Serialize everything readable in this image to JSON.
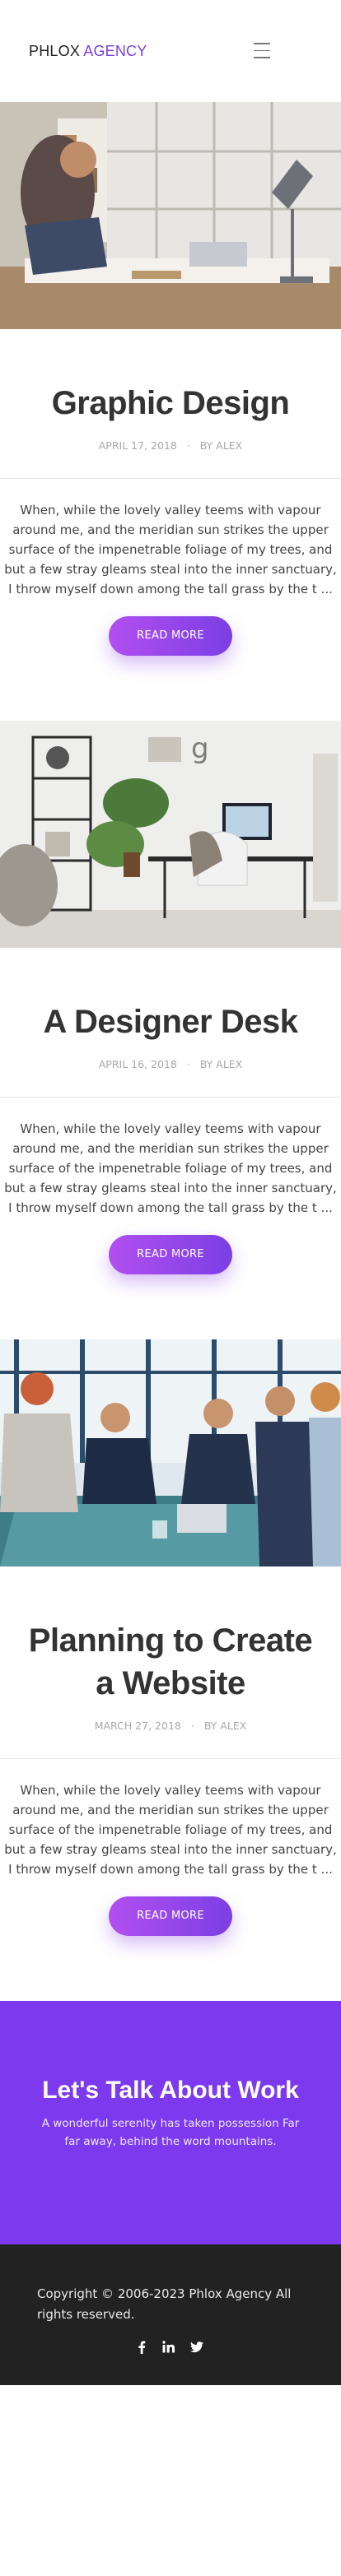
{
  "header": {
    "logo_part1": "PHLOX",
    "logo_part2": "AGENCY",
    "menu_icon": "hamburger-menu-icon"
  },
  "posts": [
    {
      "title": "Graphic Design",
      "date": "APRIL 17, 2018",
      "author": "BY ALEX",
      "excerpt": "When, while the lovely valley teems with vapour around me, and the meridian sun strikes the upper surface of the impenetrable foliage of my trees, and but a few stray gleams steal into the inner sanctuary, I throw myself down among the tall grass by the t ...",
      "button": "READ MORE"
    },
    {
      "title": "A Designer Desk",
      "date": "APRIL 16, 2018",
      "author": "BY ALEX",
      "excerpt": "When, while the lovely valley teems with vapour around me, and the meridian sun strikes the upper surface of the impenetrable foliage of my trees, and but a few stray gleams steal into the inner sanctuary, I throw myself down among the tall grass by the t ...",
      "button": "READ MORE"
    },
    {
      "title": "Planning to Create a Website",
      "date": "MARCH 27, 2018",
      "author": "BY ALEX",
      "excerpt": "When, while the lovely valley teems with vapour around me, and the meridian sun strikes the upper surface of the impenetrable foliage of my trees, and but a few stray gleams steal into the inner sanctuary, I throw myself down among the tall grass by the t ...",
      "button": "READ MORE"
    }
  ],
  "cta": {
    "title": "Let's Talk About Work",
    "text": "A wonderful serenity has taken possession Far far away, behind the word mountains."
  },
  "footer": {
    "copyright": "Copyright © 2006-2023 Phlox Agency All rights reserved.",
    "social_icons": [
      "facebook-icon",
      "linkedin-icon",
      "twitter-icon"
    ]
  },
  "colors": {
    "accent": "#7b3fe4",
    "cta_background": "#7c39ee",
    "footer_background": "#222222"
  }
}
